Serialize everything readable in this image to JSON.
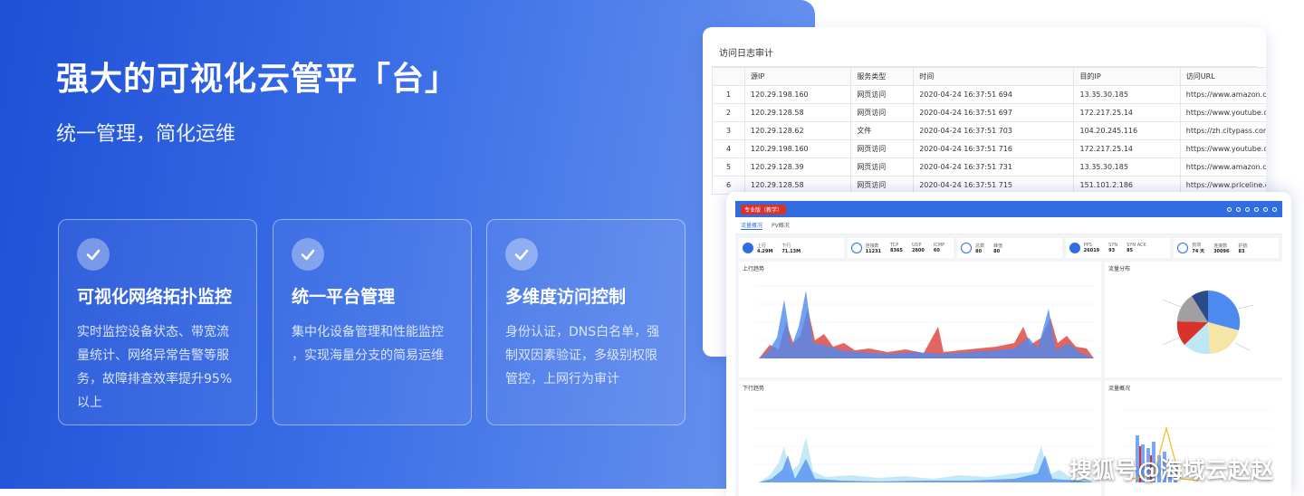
{
  "hero": {
    "title": "强大的可视化云管平「台」",
    "subtitle": "统一管理，简化运维"
  },
  "features": [
    {
      "title": "可视化网络拓扑监控",
      "lines": [
        "实时监控设备状态、带宽流",
        "量统计、网络异常告警等服",
        "务，故障排查效率提升95%",
        "以上"
      ]
    },
    {
      "title": "统一平台管理",
      "lines": [
        "集中化设备管理和性能监控",
        "，实现海量分支的简易运维"
      ]
    },
    {
      "title": "多维度访问控制",
      "lines": [
        "身份认证，DNS白名单，强",
        "制双因素验证，多级别权限",
        "管控，上网行为审计"
      ]
    }
  ],
  "log_window": {
    "title": "访问日志审计",
    "columns": [
      "",
      "源IP",
      "服务类型",
      "时间",
      "目的IP",
      "访问URL"
    ],
    "rows": [
      [
        "1",
        "120.29.198.160",
        "网页访问",
        "2020-04-24 16:37:51 694",
        "13.35.30.185",
        "https://www.amazon.c"
      ],
      [
        "2",
        "120.29.128.58",
        "网页访问",
        "2020-04-24 16:37:51 697",
        "172.217.25.14",
        "https://www.youtube.c"
      ],
      [
        "3",
        "120.29.128.62",
        "文件",
        "2020-04-24 16:37:51 703",
        "104.20.245.116",
        "https://zh.citypass.com"
      ],
      [
        "4",
        "120.29.198.160",
        "网页访问",
        "2020-04-24 16:37:51 716",
        "172.217.25.14",
        "https://www.youtube.c"
      ],
      [
        "5",
        "120.29.128.39",
        "网页访问",
        "2020-04-24 16:37:51 731",
        "13.35.30.185",
        "https://www.amazon.c"
      ],
      [
        "6",
        "120.29.128.58",
        "网页访问",
        "2020-04-24 16:37:51 715",
        "151.101.2.186",
        "https://www.priceline.c"
      ]
    ]
  },
  "dashboard": {
    "badge": "专业版（教学）",
    "tabs": [
      "流量概况",
      "PV概况"
    ],
    "stats": [
      {
        "groups": [
          {
            "label": "上行",
            "value": "4.29M"
          },
          {
            "label": "下行",
            "value": "71.13M"
          }
        ]
      },
      {
        "groups": [
          {
            "label": "连接数",
            "value": "11231"
          },
          {
            "label": "TCP",
            "value": "8365"
          },
          {
            "label": "UDP",
            "value": "2800"
          },
          {
            "label": "ICMP",
            "value": "60"
          }
        ]
      },
      {
        "groups": [
          {
            "label": "总数",
            "value": "80"
          },
          {
            "label": "峰值",
            "value": "80"
          }
        ]
      },
      {
        "groups": [
          {
            "label": "PPS",
            "value": "26019"
          },
          {
            "label": "SYN",
            "value": "93"
          },
          {
            "label": "SYN ACK",
            "value": "85"
          }
        ]
      },
      {
        "groups": [
          {
            "label": "有效",
            "value": "74 天"
          },
          {
            "label": "连接数",
            "value": "30096"
          },
          {
            "label": "护航",
            "value": "83"
          }
        ]
      }
    ],
    "panels": [
      "上行趋势",
      "流量分布",
      "下行趋势",
      "流量概况"
    ]
  },
  "colors": {
    "hero_start": "#1e4fd6",
    "hero_end": "#6d96f0",
    "accent": "#2f6de1",
    "pie": [
      "#4d8af0",
      "#f5e6a8",
      "#bde7f5",
      "#d9322b",
      "#a0a0a0",
      "#2a4a8a"
    ]
  },
  "watermark": "搜狐号@海域云赵赵"
}
